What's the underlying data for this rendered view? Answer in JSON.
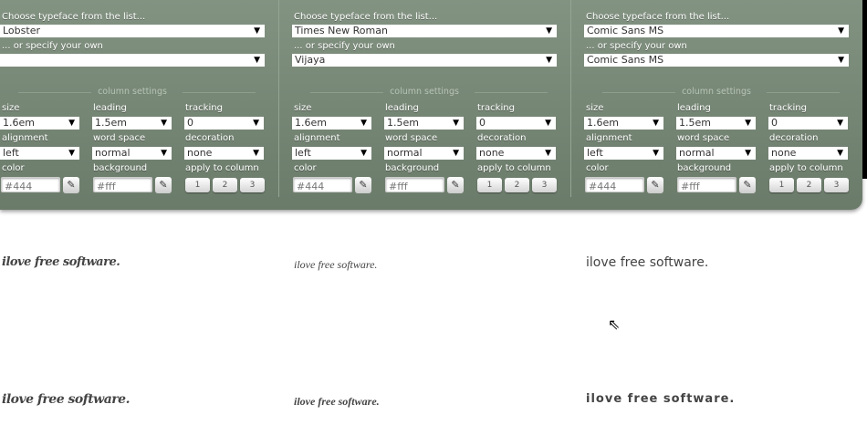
{
  "columns": [
    {
      "choose_label": "Choose typeface from the list...",
      "typeface": "Lobster",
      "own_label": "... or specify your own",
      "own_value": "",
      "settings_title": "column settings",
      "size_label": "size",
      "size": "1.6em",
      "leading_label": "leading",
      "leading": "1.5em",
      "tracking_label": "tracking",
      "tracking": "0",
      "alignment_label": "alignment",
      "alignment": "left",
      "wordspace_label": "word space",
      "wordspace": "normal",
      "decoration_label": "decoration",
      "decoration": "none",
      "color_label": "color",
      "color": "#444",
      "background_label": "background",
      "background": "#fff",
      "apply_label": "apply to column",
      "apply": [
        "1",
        "2",
        "3"
      ]
    },
    {
      "choose_label": "Choose typeface from the list...",
      "typeface": "Times New Roman",
      "own_label": "... or specify your own",
      "own_value": "Vijaya",
      "settings_title": "column settings",
      "size_label": "size",
      "size": "1.6em",
      "leading_label": "leading",
      "leading": "1.5em",
      "tracking_label": "tracking",
      "tracking": "0",
      "alignment_label": "alignment",
      "alignment": "left",
      "wordspace_label": "word space",
      "wordspace": "normal",
      "decoration_label": "decoration",
      "decoration": "none",
      "color_label": "color",
      "color": "#444",
      "background_label": "background",
      "background": "#fff",
      "apply_label": "apply to column",
      "apply": [
        "1",
        "2",
        "3"
      ]
    },
    {
      "choose_label": "Choose typeface from the list...",
      "typeface": "Comic Sans MS",
      "own_label": "... or specify your own",
      "own_value": "Comic Sans MS",
      "settings_title": "column settings",
      "size_label": "size",
      "size": "1.6em",
      "leading_label": "leading",
      "leading": "1.5em",
      "tracking_label": "tracking",
      "tracking": "0",
      "alignment_label": "alignment",
      "alignment": "left",
      "wordspace_label": "word space",
      "wordspace": "normal",
      "decoration_label": "decoration",
      "decoration": "none",
      "color_label": "color",
      "color": "#444",
      "background_label": "background",
      "background": "#fff",
      "apply_label": "apply to column",
      "apply": [
        "1",
        "2",
        "3"
      ]
    }
  ],
  "samples": {
    "text": "ilove free software.",
    "text_bold": "ilove free software."
  },
  "icons": {
    "dropdown": "▼",
    "eyedropper": "✎",
    "cursor": "⇖"
  }
}
